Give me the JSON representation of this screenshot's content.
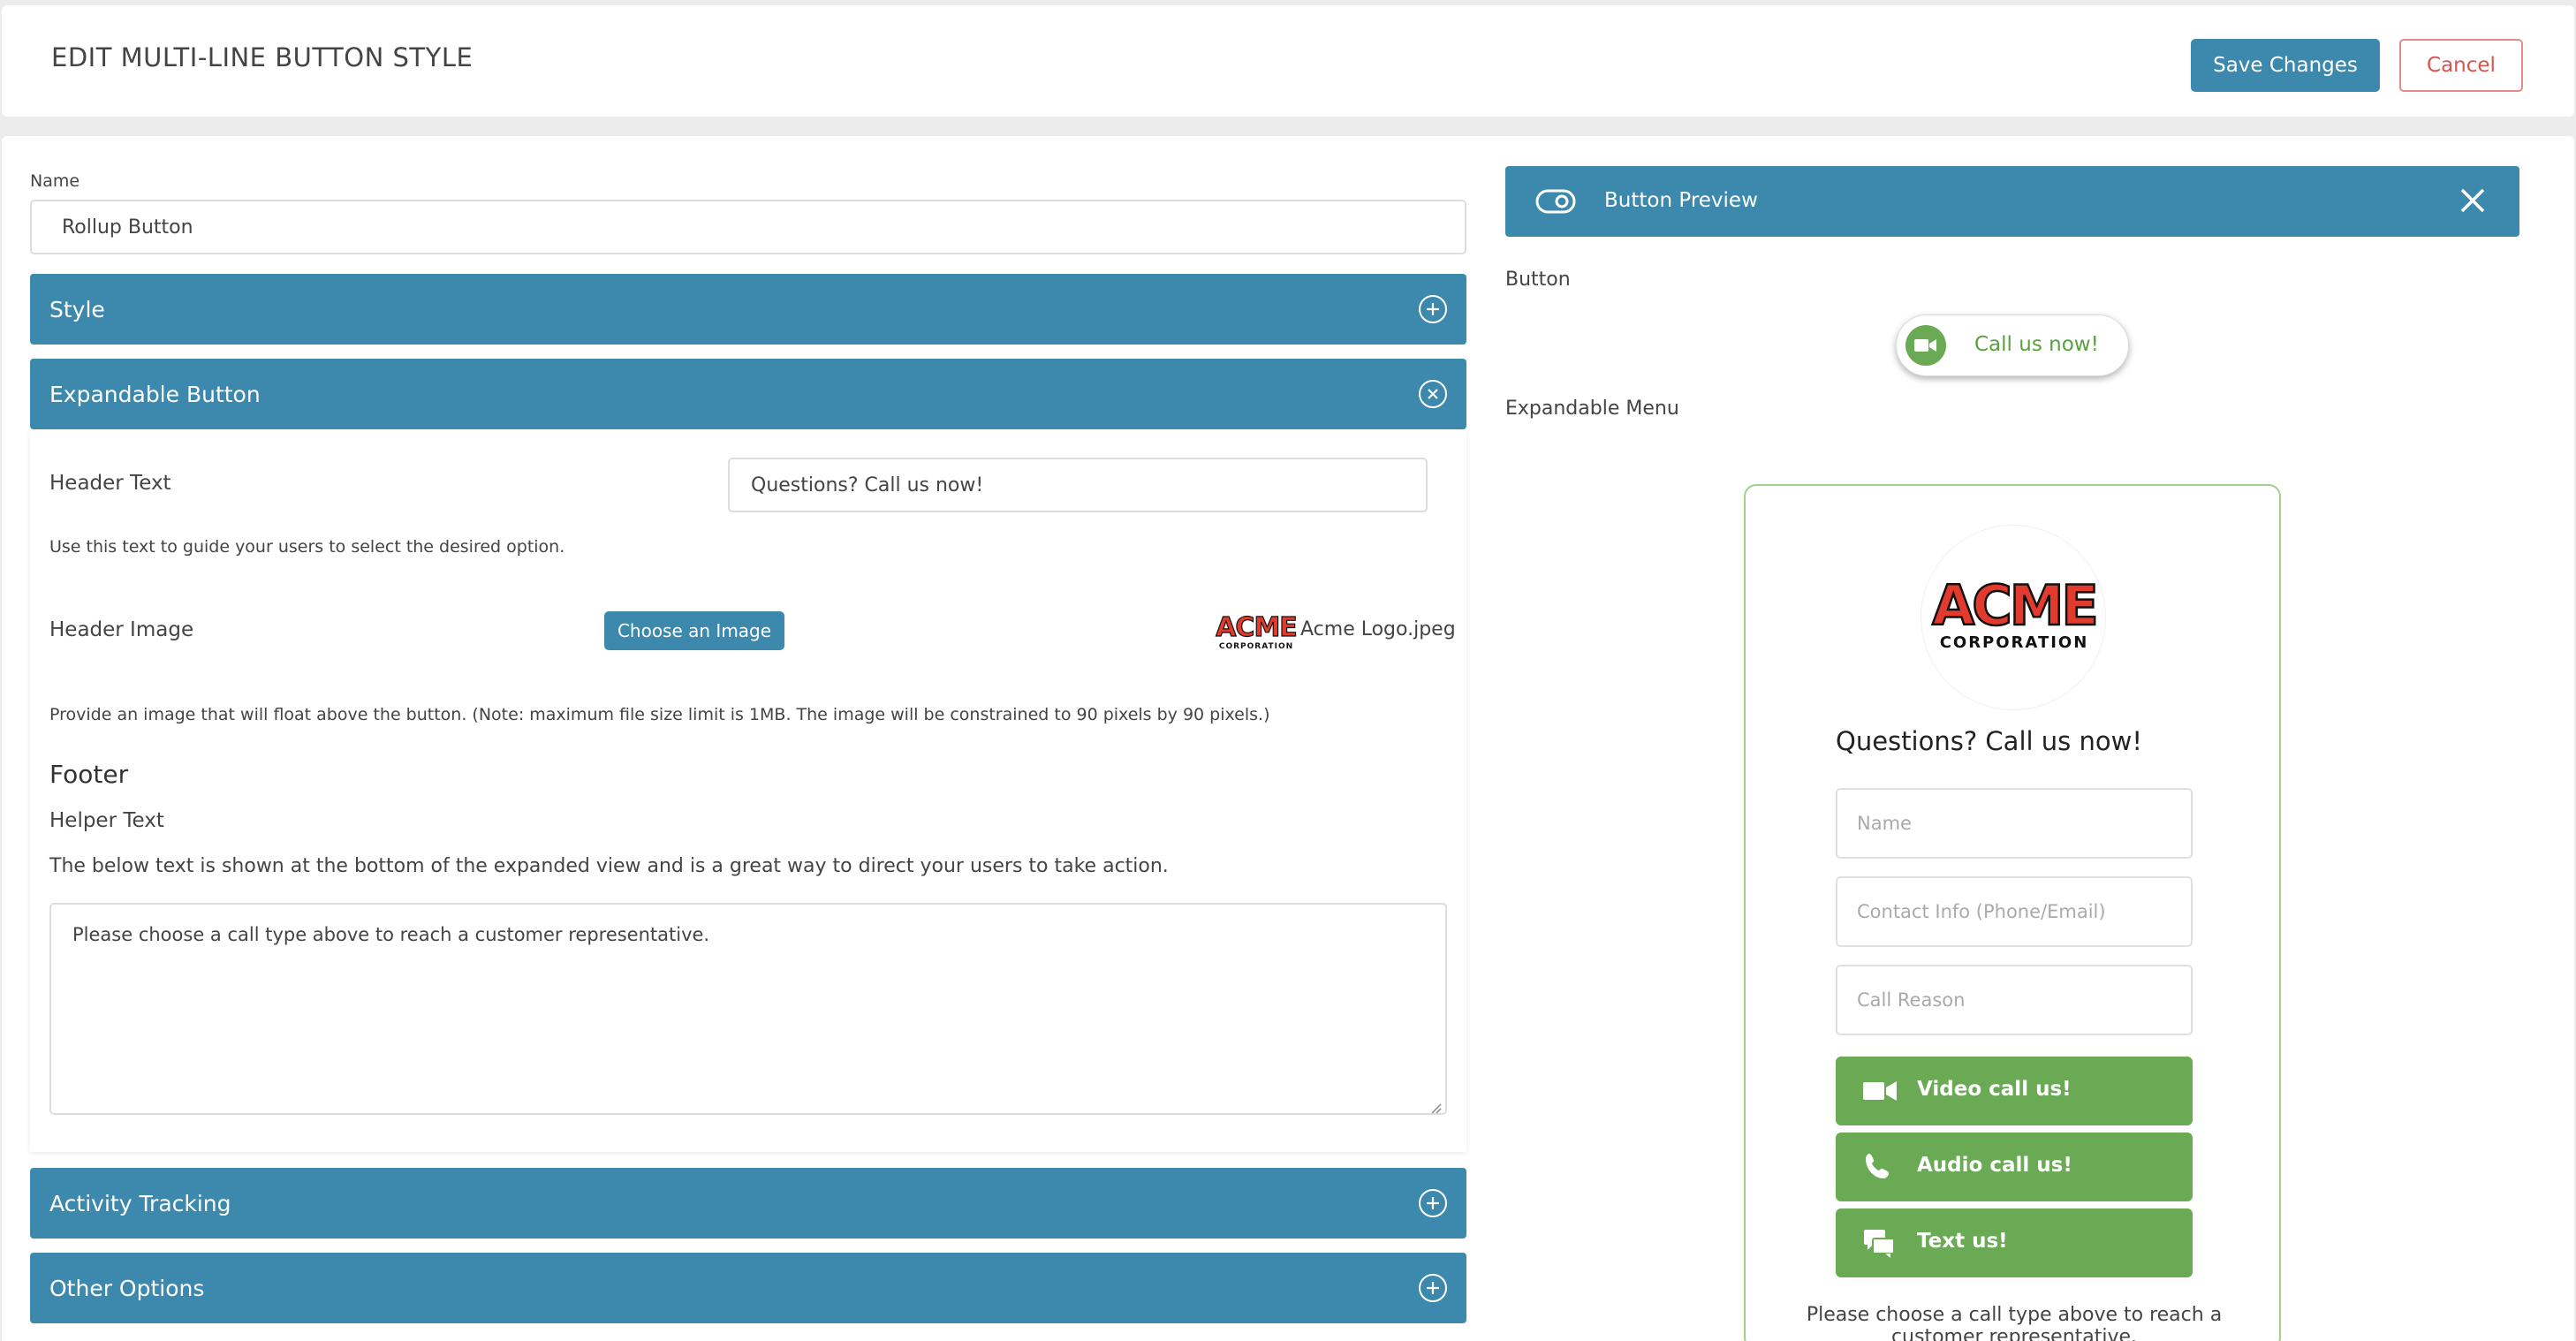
{
  "header": {
    "title": "EDIT MULTI-LINE BUTTON STYLE",
    "save_label": "Save Changes",
    "cancel_label": "Cancel"
  },
  "form": {
    "name_label": "Name",
    "name_value": "Rollup Button",
    "sections": {
      "style": "Style",
      "expandable": "Expandable Button",
      "activity": "Activity Tracking",
      "other": "Other Options"
    },
    "expandable": {
      "header_text_label": "Header Text",
      "header_text_value": "Questions? Call us now!",
      "header_text_help": "Use this text to guide your users to select the desired option.",
      "header_image_label": "Header Image",
      "choose_image_label": "Choose an Image",
      "image_filename": "Acme Logo.jpeg",
      "image_help": "Provide an image that will float above the button. (Note: maximum file size limit is 1MB. The image will be constrained to 90 pixels by 90 pixels.)",
      "footer_title": "Footer",
      "helper_text_label": "Helper Text",
      "helper_text_help": "The below text is shown at the bottom of the expanded view and is a great way to direct your users to take action.",
      "helper_text_value": "Please choose a call type above to reach a customer representative."
    }
  },
  "preview": {
    "title": "Button Preview",
    "button_label": "Button",
    "pill_text": "Call us now!",
    "expandable_label": "Expandable Menu",
    "menu": {
      "logo_main": "ACME",
      "logo_sub": "CORPORATION",
      "header_text": "Questions? Call us now!",
      "fields": [
        {
          "placeholder": "Name"
        },
        {
          "placeholder": "Contact Info (Phone/Email)"
        },
        {
          "placeholder": "Call Reason"
        }
      ],
      "buttons": [
        {
          "label": "Video call us!",
          "icon": "video-camera-icon"
        },
        {
          "label": "Audio call us!",
          "icon": "phone-icon"
        },
        {
          "label": "Text us!",
          "icon": "chat-icon"
        }
      ],
      "footer_text": "Please choose a call type above to reach a customer representative."
    }
  },
  "colors": {
    "primary": "#3c89ad",
    "danger": "#d9534f",
    "preview_green": "#6aaa55",
    "card_border": "#9fd08c",
    "logo_red": "#e23b2e"
  }
}
